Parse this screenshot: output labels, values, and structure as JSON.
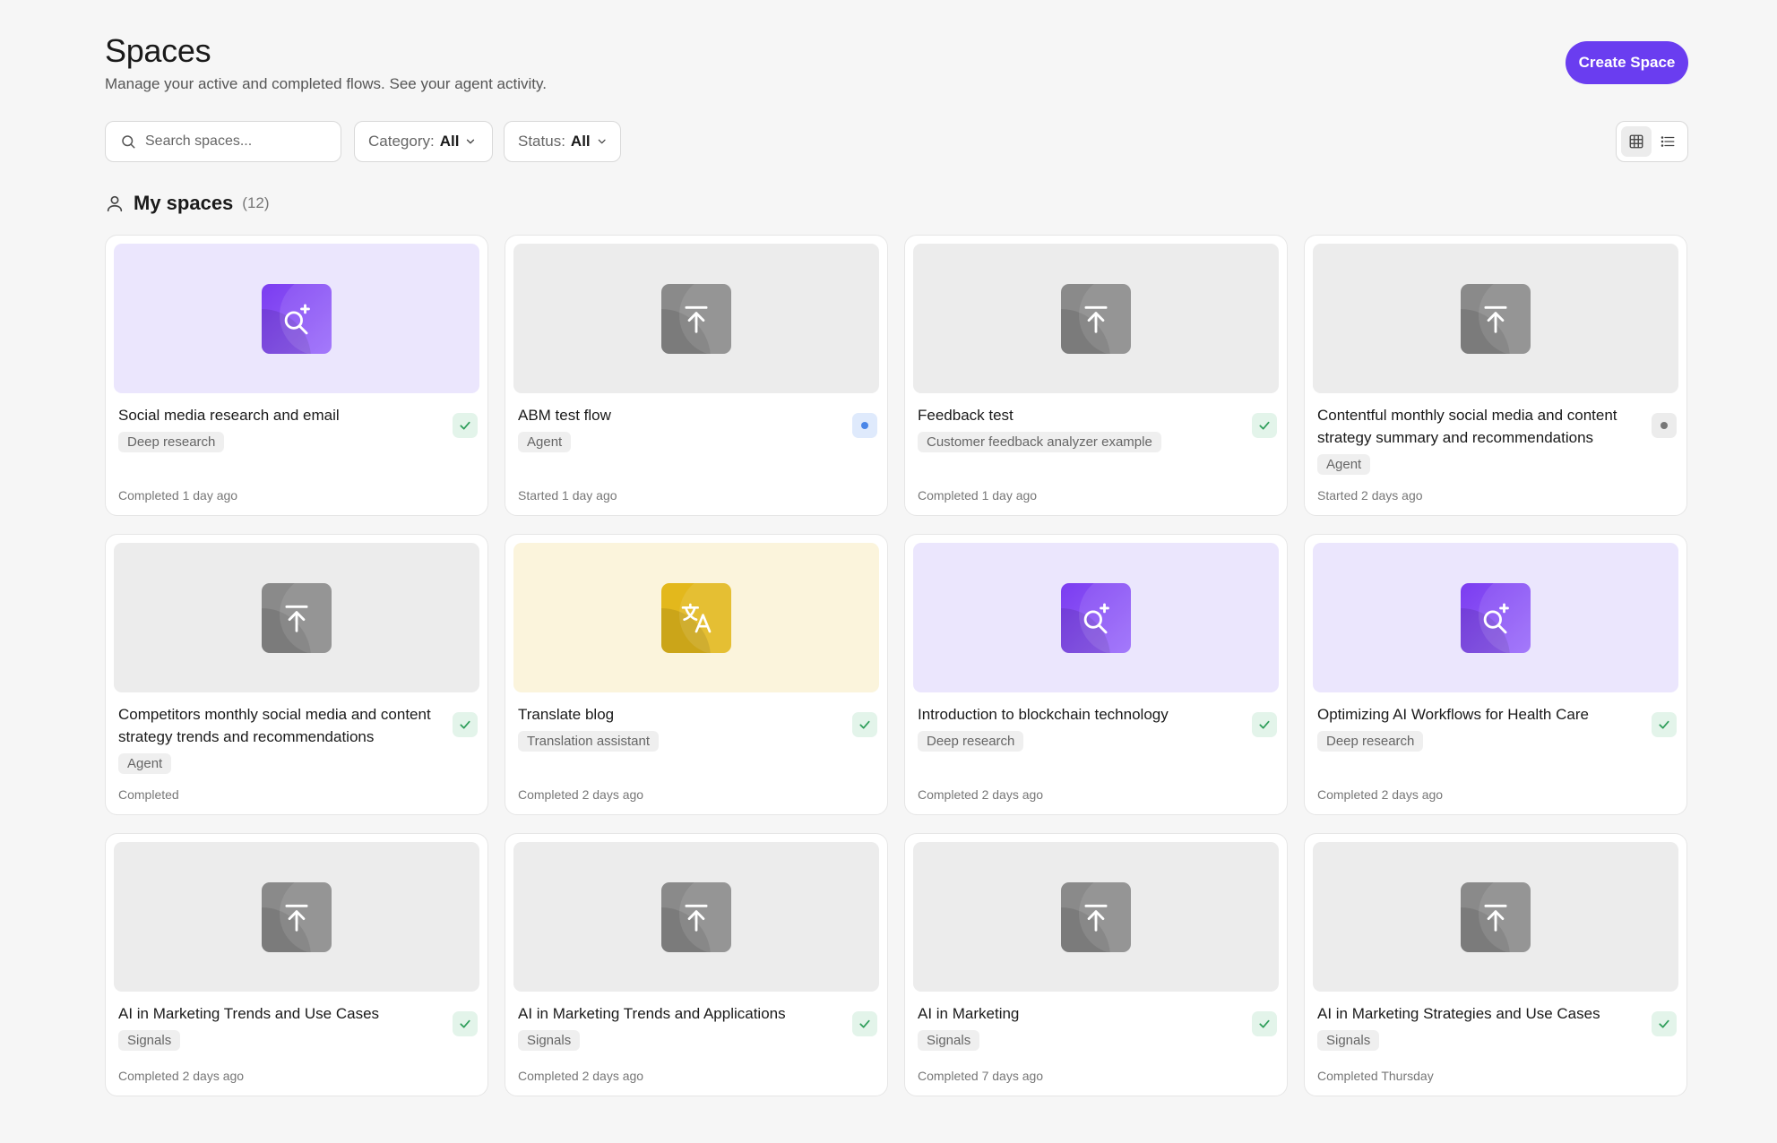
{
  "page": {
    "title": "Spaces",
    "subtitle": "Manage your active and completed flows. See your agent activity.",
    "create_button": "Create Space"
  },
  "toolbar": {
    "search_placeholder": "Search spaces...",
    "category_label": "Category:",
    "category_value": "All",
    "status_label": "Status:",
    "status_value": "All",
    "view_mode_selected": "grid"
  },
  "section": {
    "label": "My spaces",
    "count": "(12)"
  },
  "colors": {
    "accent": "#6a3df0",
    "done": "#2f9e5b",
    "running": "#4a86e8",
    "idle": "#777777"
  },
  "cards": [
    {
      "title": "Social media research and email",
      "tag": "Deep research",
      "footer": "Completed 1 day ago",
      "theme": "purple",
      "icon": "search-sparkle-icon",
      "status": "done"
    },
    {
      "title": "ABM test flow",
      "tag": "Agent",
      "footer": "Started 1 day ago",
      "theme": "gray",
      "icon": "upload-icon",
      "status": "running"
    },
    {
      "title": "Feedback test",
      "tag": "Customer feedback analyzer example",
      "footer": "Completed 1 day ago",
      "theme": "gray",
      "icon": "upload-icon",
      "status": "done"
    },
    {
      "title": "Contentful monthly social media and content strategy summary and recommendations",
      "tag": "Agent",
      "footer": "Started 2 days ago",
      "theme": "gray",
      "icon": "upload-icon",
      "status": "idle"
    },
    {
      "title": "Competitors monthly social media and content strategy trends and recommendations",
      "tag": "Agent",
      "footer": "Completed",
      "theme": "gray",
      "icon": "upload-icon",
      "status": "done"
    },
    {
      "title": "Translate blog",
      "tag": "Translation assistant",
      "footer": "Completed 2 days ago",
      "theme": "yellow",
      "icon": "translate-icon",
      "status": "done"
    },
    {
      "title": "Introduction to blockchain technology",
      "tag": "Deep research",
      "footer": "Completed 2 days ago",
      "theme": "purple",
      "icon": "search-sparkle-icon",
      "status": "done"
    },
    {
      "title": "Optimizing AI Workflows for Health Care",
      "tag": "Deep research",
      "footer": "Completed 2 days ago",
      "theme": "purple",
      "icon": "search-sparkle-icon",
      "status": "done"
    },
    {
      "title": "AI in Marketing Trends and Use Cases",
      "tag": "Signals",
      "footer": "Completed 2 days ago",
      "theme": "gray",
      "icon": "upload-icon",
      "status": "done"
    },
    {
      "title": "AI in Marketing Trends and Applications",
      "tag": "Signals",
      "footer": "Completed 2 days ago",
      "theme": "gray",
      "icon": "upload-icon",
      "status": "done"
    },
    {
      "title": "AI in Marketing",
      "tag": "Signals",
      "footer": "Completed 7 days ago",
      "theme": "gray",
      "icon": "upload-icon",
      "status": "done"
    },
    {
      "title": "AI in Marketing Strategies and Use Cases",
      "tag": "Signals",
      "footer": "Completed Thursday",
      "theme": "gray",
      "icon": "upload-icon",
      "status": "done"
    }
  ]
}
